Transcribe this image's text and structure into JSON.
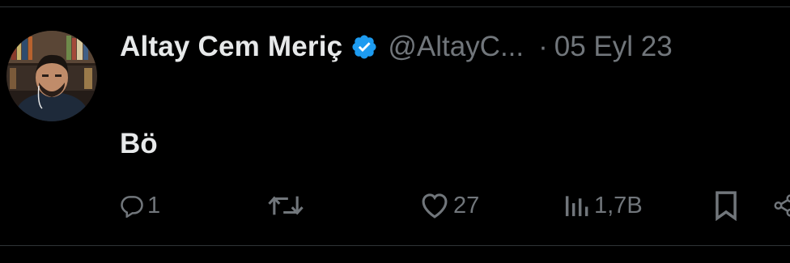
{
  "tweet": {
    "author": {
      "display_name": "Altay Cem Meriç",
      "handle": "@AltayC...",
      "verified": true
    },
    "separator": "·",
    "timestamp": "05 Eyl 23",
    "text": "Bö"
  },
  "actions": {
    "reply_count": "1",
    "retweet_count": "",
    "like_count": "27",
    "views_count": "1,7B"
  },
  "colors": {
    "background": "#000000",
    "primary_text": "#e7e9ea",
    "secondary_text": "#71767b",
    "verified_badge": "#1d9bf0",
    "divider": "#2f3336"
  },
  "icons": {
    "reply": "reply-icon",
    "retweet": "retweet-icon",
    "like": "heart-icon",
    "views": "views-icon",
    "bookmark": "bookmark-icon",
    "share": "share-icon",
    "verified": "verified-badge-icon"
  }
}
